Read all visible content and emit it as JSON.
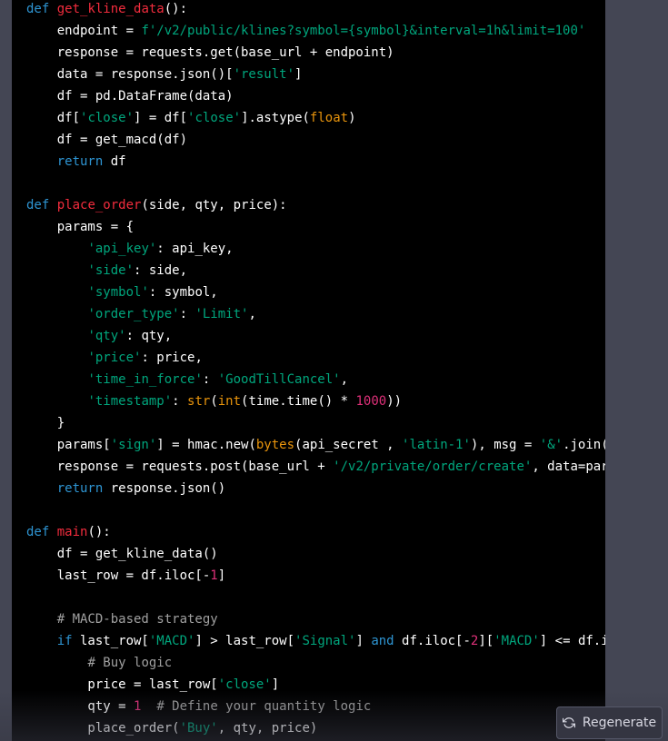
{
  "colors": {
    "page_background": "#444654",
    "code_background": "#000000",
    "plain": "#ffffff",
    "keyword": "#2e95d3",
    "function": "#f22c3d",
    "string": "#00a67d",
    "builtin": "#e9950c",
    "number": "#df3079",
    "comment": "#a0a0a0"
  },
  "code": {
    "language": "python",
    "lines": [
      [
        [
          "kw",
          "def"
        ],
        [
          "plain",
          " "
        ],
        [
          "fn",
          "get_kline_data"
        ],
        [
          "plain",
          "():"
        ]
      ],
      [
        [
          "plain",
          "    endpoint = "
        ],
        [
          "str",
          "f'/v2/public/klines?symbol={symbol}&interval=1h&limit=100'"
        ]
      ],
      [
        [
          "plain",
          "    response = requests.get(base_url + endpoint)"
        ]
      ],
      [
        [
          "plain",
          "    data = response.json()["
        ],
        [
          "str",
          "'result'"
        ],
        [
          "plain",
          "]"
        ]
      ],
      [
        [
          "plain",
          "    df = pd.DataFrame(data)"
        ]
      ],
      [
        [
          "plain",
          "    df["
        ],
        [
          "str",
          "'close'"
        ],
        [
          "plain",
          "] = df["
        ],
        [
          "str",
          "'close'"
        ],
        [
          "plain",
          "].astype("
        ],
        [
          "builtin",
          "float"
        ],
        [
          "plain",
          ")"
        ]
      ],
      [
        [
          "plain",
          "    df = get_macd(df)"
        ]
      ],
      [
        [
          "plain",
          "    "
        ],
        [
          "kw",
          "return"
        ],
        [
          "plain",
          " df"
        ]
      ],
      [],
      [
        [
          "kw",
          "def"
        ],
        [
          "plain",
          " "
        ],
        [
          "fn",
          "place_order"
        ],
        [
          "plain",
          "(side, qty, price):"
        ]
      ],
      [
        [
          "plain",
          "    params = {"
        ]
      ],
      [
        [
          "plain",
          "        "
        ],
        [
          "str",
          "'api_key'"
        ],
        [
          "plain",
          ": api_key,"
        ]
      ],
      [
        [
          "plain",
          "        "
        ],
        [
          "str",
          "'side'"
        ],
        [
          "plain",
          ": side,"
        ]
      ],
      [
        [
          "plain",
          "        "
        ],
        [
          "str",
          "'symbol'"
        ],
        [
          "plain",
          ": symbol,"
        ]
      ],
      [
        [
          "plain",
          "        "
        ],
        [
          "str",
          "'order_type'"
        ],
        [
          "plain",
          ": "
        ],
        [
          "str",
          "'Limit'"
        ],
        [
          "plain",
          ","
        ]
      ],
      [
        [
          "plain",
          "        "
        ],
        [
          "str",
          "'qty'"
        ],
        [
          "plain",
          ": qty,"
        ]
      ],
      [
        [
          "plain",
          "        "
        ],
        [
          "str",
          "'price'"
        ],
        [
          "plain",
          ": price,"
        ]
      ],
      [
        [
          "plain",
          "        "
        ],
        [
          "str",
          "'time_in_force'"
        ],
        [
          "plain",
          ": "
        ],
        [
          "str",
          "'GoodTillCancel'"
        ],
        [
          "plain",
          ","
        ]
      ],
      [
        [
          "plain",
          "        "
        ],
        [
          "str",
          "'timestamp'"
        ],
        [
          "plain",
          ": "
        ],
        [
          "builtin",
          "str"
        ],
        [
          "plain",
          "("
        ],
        [
          "builtin",
          "int"
        ],
        [
          "plain",
          "(time.time() * "
        ],
        [
          "num",
          "1000"
        ],
        [
          "plain",
          "))"
        ]
      ],
      [
        [
          "plain",
          "    }"
        ]
      ],
      [
        [
          "plain",
          "    params["
        ],
        [
          "str",
          "'sign'"
        ],
        [
          "plain",
          "] = hmac.new("
        ],
        [
          "builtin",
          "bytes"
        ],
        [
          "plain",
          "(api_secret , "
        ],
        [
          "str",
          "'latin-1'"
        ],
        [
          "plain",
          "), msg = "
        ],
        [
          "str",
          "'&'"
        ],
        [
          "plain",
          ".join("
        ]
      ],
      [
        [
          "plain",
          "    response = requests.post(base_url + "
        ],
        [
          "str",
          "'/v2/private/order/create'"
        ],
        [
          "plain",
          ", data=par"
        ]
      ],
      [
        [
          "plain",
          "    "
        ],
        [
          "kw",
          "return"
        ],
        [
          "plain",
          " response.json()"
        ]
      ],
      [],
      [
        [
          "kw",
          "def"
        ],
        [
          "plain",
          " "
        ],
        [
          "fn",
          "main"
        ],
        [
          "plain",
          "():"
        ]
      ],
      [
        [
          "plain",
          "    df = get_kline_data()"
        ]
      ],
      [
        [
          "plain",
          "    last_row = df.iloc[-"
        ],
        [
          "num",
          "1"
        ],
        [
          "plain",
          "]"
        ]
      ],
      [],
      [
        [
          "plain",
          "    "
        ],
        [
          "cmt",
          "# MACD-based strategy"
        ]
      ],
      [
        [
          "plain",
          "    "
        ],
        [
          "kw",
          "if"
        ],
        [
          "plain",
          " last_row["
        ],
        [
          "str",
          "'MACD'"
        ],
        [
          "plain",
          "] > last_row["
        ],
        [
          "str",
          "'Signal'"
        ],
        [
          "plain",
          "] "
        ],
        [
          "kw",
          "and"
        ],
        [
          "plain",
          " df.iloc[-"
        ],
        [
          "num",
          "2"
        ],
        [
          "plain",
          "]["
        ],
        [
          "str",
          "'MACD'"
        ],
        [
          "plain",
          "] <= df.i"
        ]
      ],
      [
        [
          "plain",
          "        "
        ],
        [
          "cmt",
          "# Buy logic"
        ]
      ],
      [
        [
          "plain",
          "        price = last_row["
        ],
        [
          "str",
          "'close'"
        ],
        [
          "plain",
          "]"
        ]
      ],
      [
        [
          "plain",
          "        qty = "
        ],
        [
          "num",
          "1"
        ],
        [
          "plain",
          "  "
        ],
        [
          "cmt",
          "# Define your quantity logic"
        ]
      ],
      [
        [
          "plain",
          "        place_order("
        ],
        [
          "str",
          "'Buy'"
        ],
        [
          "plain",
          ", qty, price)"
        ]
      ]
    ]
  },
  "regenerate_button": {
    "label": "Regenerate",
    "icon": "refresh-icon"
  }
}
